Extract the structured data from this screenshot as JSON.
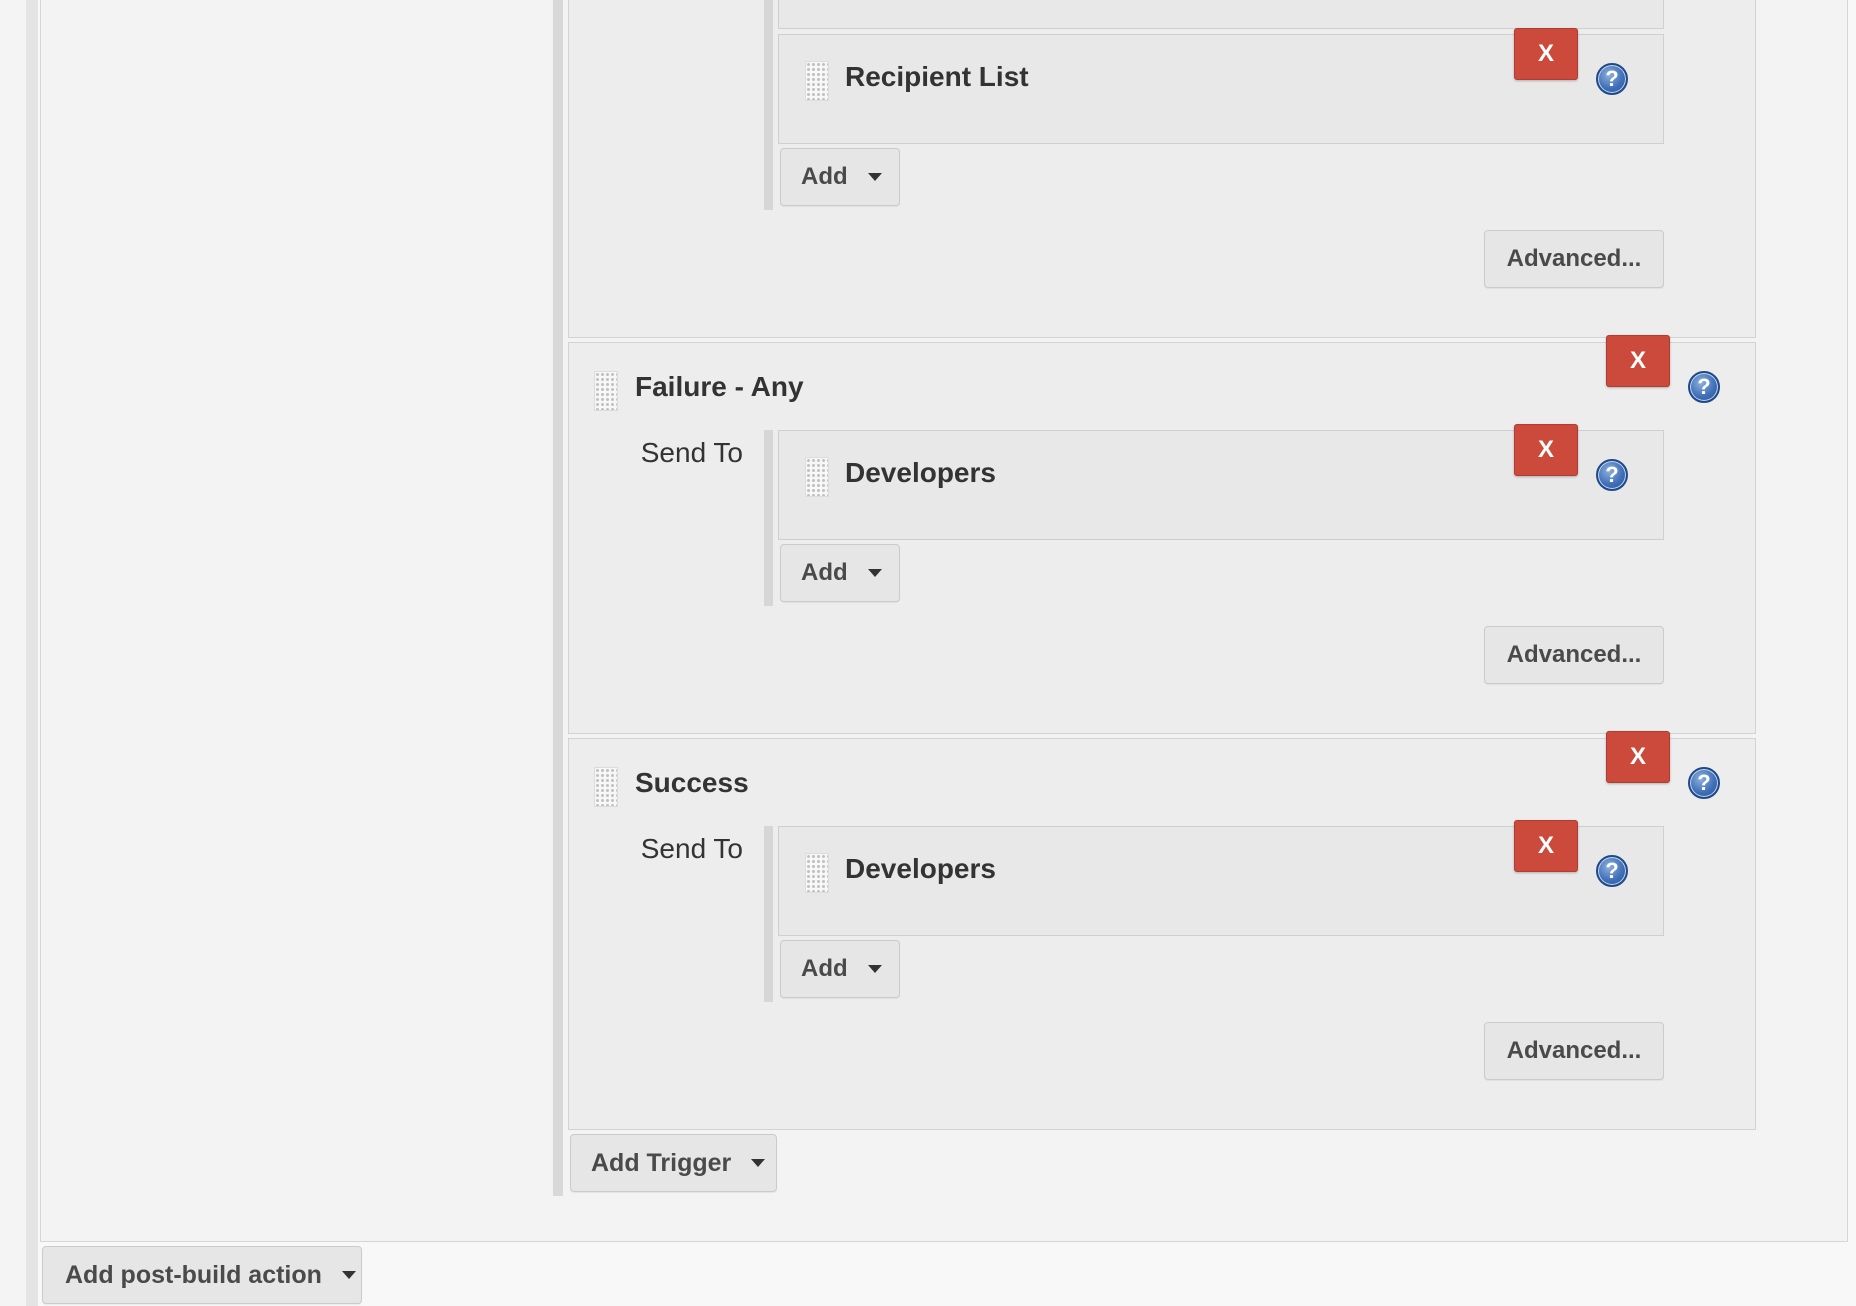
{
  "labels": {
    "send_to": "Send To",
    "remove": "X",
    "help": "?",
    "add": "Add",
    "advanced": "Advanced..."
  },
  "triggers": [
    {
      "title": "",
      "recipients": [
        "Recipient List"
      ]
    },
    {
      "title": "Failure - Any",
      "recipients": [
        "Developers"
      ]
    },
    {
      "title": "Success",
      "recipients": [
        "Developers"
      ]
    }
  ],
  "add_trigger_label": "Add Trigger",
  "add_post_build_label": "Add post-build action",
  "colors": {
    "remove_button": "#cc4a3b",
    "help_icon": "#3f6fb8",
    "button_bg": "#e6e6e6",
    "panel_bg": "#ededed"
  }
}
